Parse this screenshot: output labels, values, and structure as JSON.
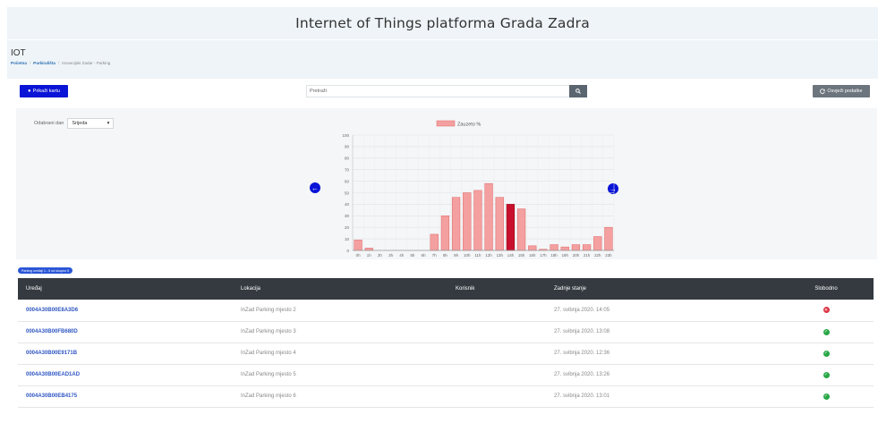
{
  "header": {
    "title": "Internet of Things platforma Grada Zadra"
  },
  "crumbbar": {
    "title": "IOT",
    "breadcrumbs": [
      "Početna",
      "Parkirališta",
      "Inovacijski Zadar - Parking"
    ]
  },
  "toolbar": {
    "map_label": "Prikaži kartu",
    "search_placeholder": "Pretraži",
    "refresh_label": "Osvježi podatke"
  },
  "day_select": {
    "label": "Odabrani dan",
    "value": "Srijeda"
  },
  "chart_data": {
    "type": "bar",
    "legend": "Zauzeto %",
    "categories": [
      "0h",
      "1h",
      "2h",
      "3h",
      "4h",
      "5h",
      "6h",
      "7h",
      "8h",
      "9h",
      "10h",
      "11h",
      "12h",
      "13h",
      "14h",
      "15h",
      "16h",
      "17h",
      "18h",
      "19h",
      "20h",
      "21h",
      "22h",
      "23h"
    ],
    "values": [
      9,
      2,
      0,
      0,
      0,
      0,
      0,
      14,
      30,
      46,
      50,
      52,
      58,
      46,
      40,
      36,
      4,
      1,
      5,
      3,
      5,
      5,
      12,
      20
    ],
    "highlight_index": 14,
    "ylim": [
      0,
      100
    ],
    "yticks": [
      0,
      10,
      20,
      30,
      40,
      50,
      60,
      70,
      80,
      90,
      100
    ],
    "colors": {
      "bar": "#f4a0a0",
      "bar_border": "#e06666",
      "highlight": "#c8102e",
      "highlight_border": "#8b0000"
    }
  },
  "table": {
    "badge": "Parking uređaji 1 - 5 od ukupno 5",
    "columns": [
      "Uređaj",
      "Lokacija",
      "Korisnik",
      "Zadnje stanje",
      "Slobodno"
    ],
    "rows": [
      {
        "device": "0004A30B00E8A3D6",
        "location": "InZad Parking mjesto 2",
        "user": "",
        "last_state": "27. svibnja 2020. 14:05",
        "free": false
      },
      {
        "device": "0004A30B00FB680D",
        "location": "InZad Parking mjesto 3",
        "user": "",
        "last_state": "27. svibnja 2020. 13:08",
        "free": true
      },
      {
        "device": "0004A30B00E9171B",
        "location": "InZad Parking mjesto 4",
        "user": "",
        "last_state": "27. svibnja 2020. 12:36",
        "free": true
      },
      {
        "device": "0004A30B00EAD1AD",
        "location": "InZad Parking mjesto 5",
        "user": "",
        "last_state": "27. svibnja 2020. 13:26",
        "free": true
      },
      {
        "device": "0004A30B00EB4175",
        "location": "InZad Parking mjesto 6",
        "user": "",
        "last_state": "27. svibnja 2020. 13:01",
        "free": true
      }
    ]
  }
}
